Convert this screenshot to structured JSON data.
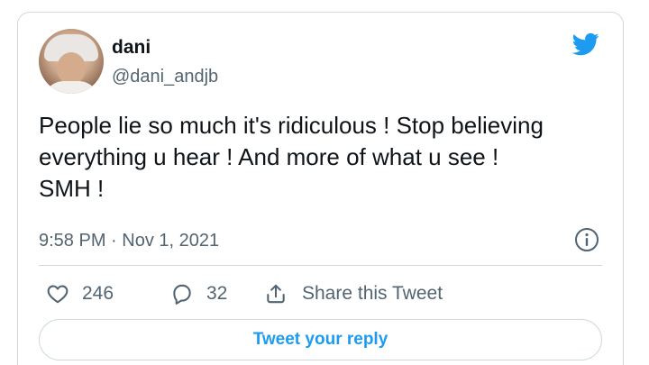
{
  "author": {
    "display_name": "dani",
    "handle": "@dani_andjb"
  },
  "tweet": {
    "text": "People lie so much it's ridiculous ! Stop believing\neverything u hear ! And more of what u see !\nSMH !",
    "timestamp": "9:58 PM · Nov 1, 2021"
  },
  "actions": {
    "like_count": "246",
    "reply_count": "32",
    "share_label": "Share this Tweet"
  },
  "reply_button_label": "Tweet your reply",
  "icons": {
    "brand": "twitter-bird-icon",
    "info": "info-icon",
    "like": "heart-icon",
    "reply": "comment-bubble-icon",
    "share": "share-icon"
  },
  "colors": {
    "brand_blue": "#1d9bf0",
    "text_primary": "#0f1419",
    "text_secondary": "#536471",
    "border": "#cfd9de"
  }
}
